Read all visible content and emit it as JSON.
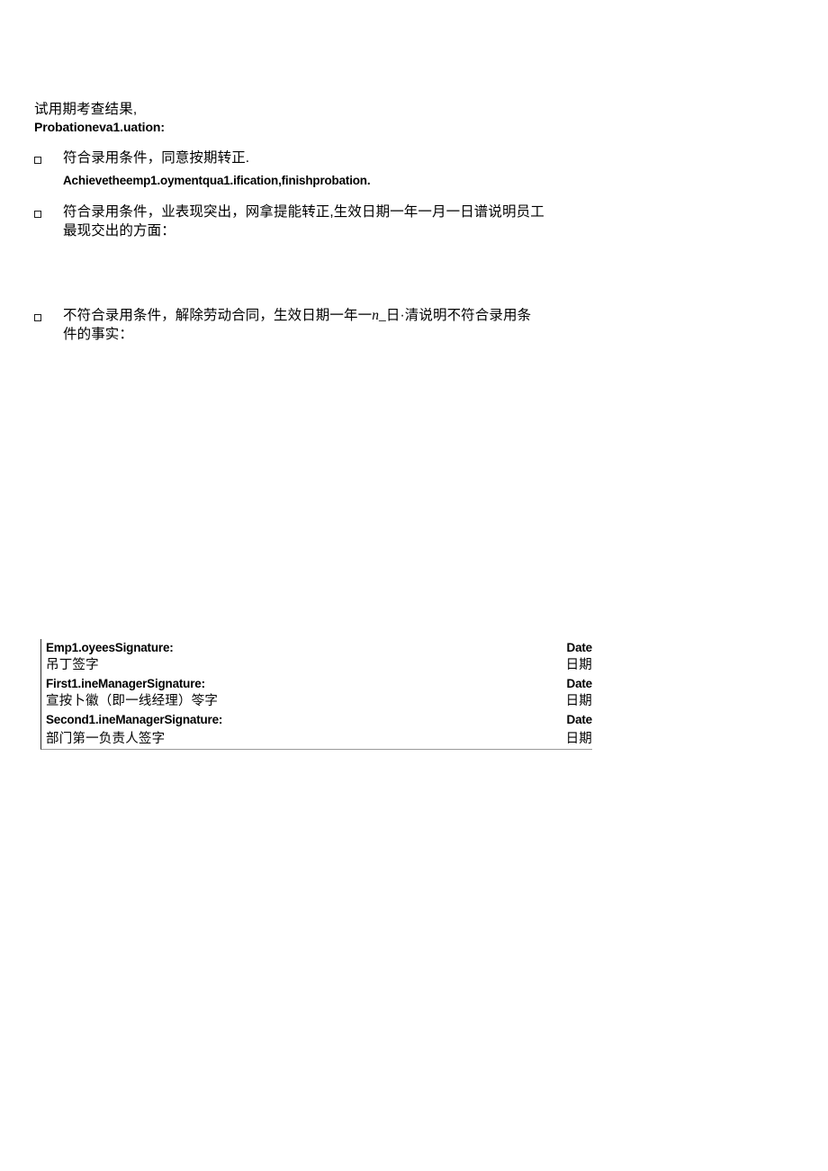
{
  "document": {
    "heading": {
      "chinese": "试用期考查结果,",
      "english": "Probationeva1.uation:"
    },
    "options": [
      {
        "checkbox_icon": "checkbox-empty-icon",
        "chinese": "符合录用条件，同意按期转正.",
        "english": "Achievetheemp1.oymentqua1.ification,finishprobation."
      },
      {
        "checkbox_icon": "checkbox-empty-icon",
        "chinese_line_1": "符合录用条件，业表现突出，网拿提能转正,生效日期一年一月一日谱说明员工",
        "chinese_line_2": "最现交出的方面：",
        "english": ""
      },
      {
        "checkbox_icon": "checkbox-empty-icon",
        "chinese_line_1_pre": "不符合录用条件，解除劳动合同，生效日期一年一",
        "chinese_line_1_italic": "n_",
        "chinese_line_1_post": "日·清说明不符合录用条",
        "chinese_line_2": "件的事实：",
        "english": ""
      }
    ],
    "signature_table": {
      "rows": [
        {
          "label": "Emp1.oyeesSignature:",
          "date": "Date",
          "lang": "en"
        },
        {
          "label": "吊丁签字",
          "date": "日期",
          "lang": "cn"
        },
        {
          "label": "First1.ineManagerSignature:",
          "date": "Date",
          "lang": "en"
        },
        {
          "label": "宣按卜徽（即一线经理）笭字",
          "date": "日期",
          "lang": "cn"
        },
        {
          "label": "Second1.ineManagerSignature:",
          "date": "Date",
          "lang": "en"
        },
        {
          "label": "部门第一负责人签字",
          "date": "日期",
          "lang": "cn"
        }
      ]
    }
  }
}
